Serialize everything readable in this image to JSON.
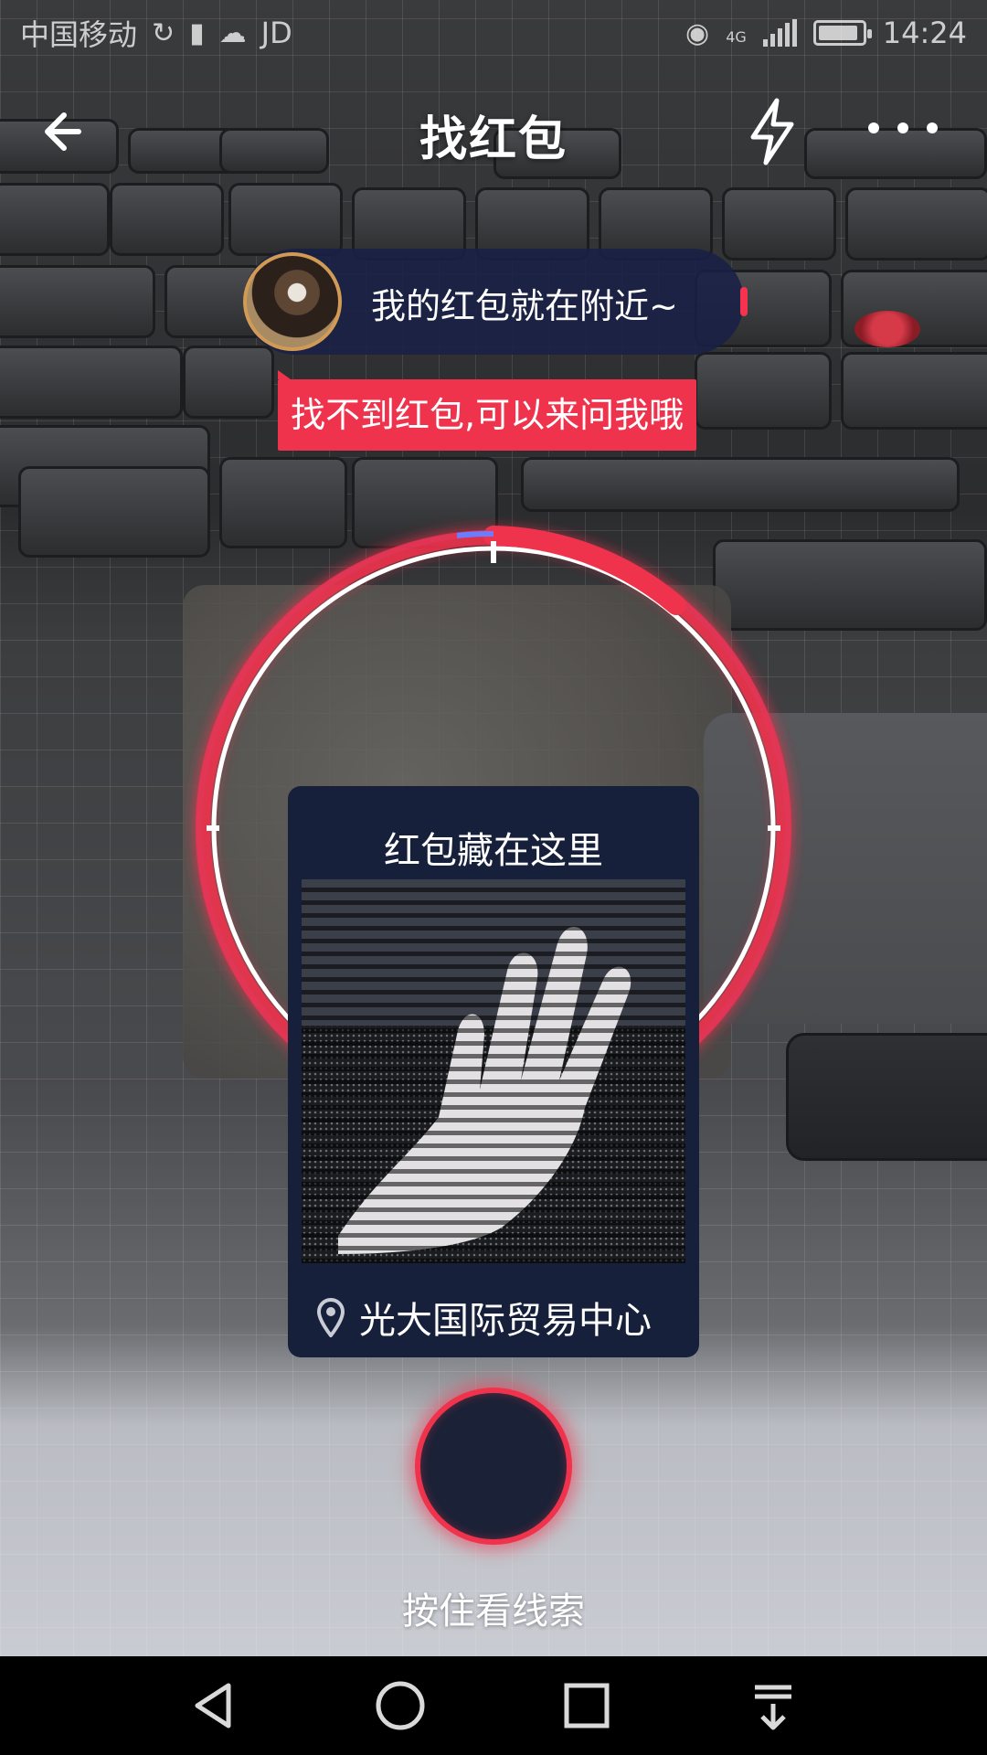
{
  "status_bar": {
    "carrier": "中国移动",
    "extra_label": "JD",
    "network": "4G",
    "time": "14:24",
    "icons": [
      "weibo-icon",
      "notification-icon",
      "wechat-icon",
      "eye-icon",
      "signal-icon",
      "battery-icon"
    ]
  },
  "header": {
    "title": "找红包",
    "back_icon": "arrow-left-icon",
    "flash_icon": "lightning-icon",
    "more_icon": "more-horizontal-icon"
  },
  "assistant": {
    "message": "我的红包就在附近~",
    "hint": "找不到红包,可以来问我哦"
  },
  "clue_card": {
    "title": "红包藏在这里",
    "location_icon": "location-pin-icon",
    "location": "光大国际贸易中心"
  },
  "hold_button": {
    "label": "按住看线索"
  },
  "nav_bar": {
    "icons": [
      "back-triangle-icon",
      "home-circle-icon",
      "recents-square-icon",
      "notification-pull-icon"
    ]
  },
  "colors": {
    "accent": "#f0334d",
    "card_bg": "#17203a",
    "bubble_bg": "#192046"
  }
}
